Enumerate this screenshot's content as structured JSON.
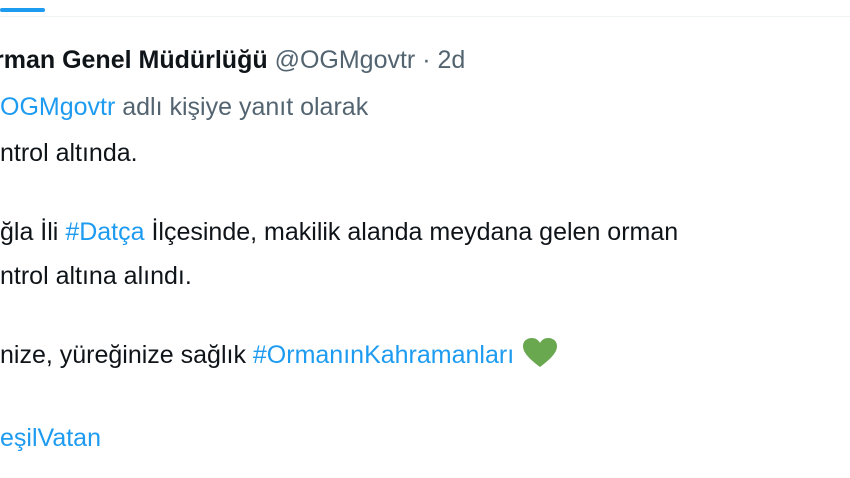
{
  "header": {
    "name": "rman Genel Müdürlüğü",
    "handle": "@OGMgovtr",
    "separator": "·",
    "time": "2d"
  },
  "reply": {
    "mention": "OGMgovtr",
    "text": " adlı kişiye yanıt olarak"
  },
  "tweet": {
    "line1": "ntrol altında.",
    "line2_a": "ğla İli ",
    "line2_hashtag": "#Datça",
    "line2_b": " İlçesinde, makilik alanda meydana gelen orman",
    "line3": "ntrol altına alındı.",
    "line4_a": "nize, yüreğinize sağlık ",
    "line4_hashtag": "#OrmanınKahramanları",
    "line4_emoji": "green-heart-icon",
    "line5_hashtag": "eşilVatan"
  },
  "colors": {
    "link": "#1d9bf0",
    "secondary": "#536471",
    "heart": "#6aa84f"
  }
}
